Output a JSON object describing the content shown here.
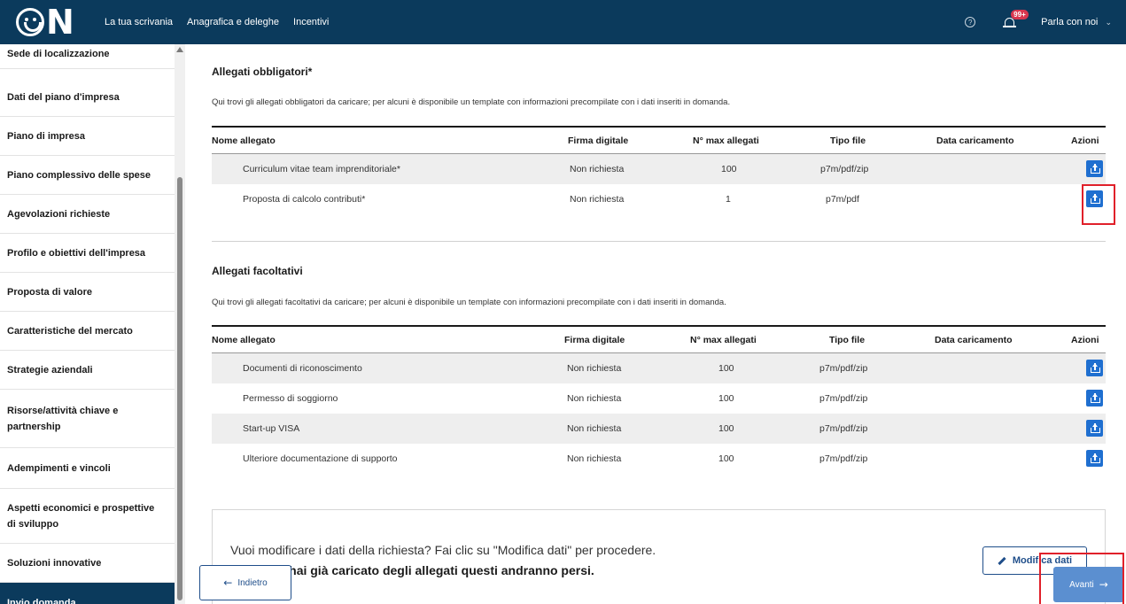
{
  "header": {
    "logo_text": "N",
    "nav": [
      "La tua scrivania",
      "Anagrafica e deleghe",
      "Incentivi"
    ],
    "help_glyph": "?",
    "notification_badge": "99+",
    "chat_label": "Parla con noi",
    "chat_chevron": "⌄"
  },
  "sidebar": {
    "items": [
      "Sede di localizzazione",
      "Dati del piano d'impresa",
      "Piano di impresa",
      "Piano complessivo delle spese",
      "Agevolazioni richieste",
      "Profilo e obiettivi dell'impresa",
      "Proposta di valore",
      "Caratteristiche del mercato",
      "Strategie aziendali",
      "Risorse/attività chiave e partnership",
      "Adempimenti e vincoli",
      "Aspetti economici e prospettive di sviluppo",
      "Soluzioni innovative",
      "Invio domanda"
    ]
  },
  "columns": {
    "name": "Nome allegato",
    "signature": "Firma digitale",
    "max": "N° max allegati",
    "type": "Tipo file",
    "date": "Data caricamento",
    "actions": "Azioni"
  },
  "mandatory": {
    "title": "Allegati obbligatori*",
    "description": "Qui trovi gli allegati obbligatori da caricare; per alcuni è disponibile un template con informazioni precompilate con i dati inseriti in domanda.",
    "rows": [
      {
        "name": "Curriculum vitae team imprenditoriale*",
        "signature": "Non richiesta",
        "max": "100",
        "type": "p7m/pdf/zip",
        "date": ""
      },
      {
        "name": "Proposta di calcolo contributi*",
        "signature": "Non richiesta",
        "max": "1",
        "type": "p7m/pdf",
        "date": ""
      }
    ]
  },
  "optional": {
    "title": "Allegati facoltativi",
    "description": "Qui trovi gli allegati facoltativi da caricare; per alcuni è disponibile un template con informazioni precompilate con i dati inseriti in domanda.",
    "rows": [
      {
        "name": "Documenti di riconoscimento",
        "signature": "Non richiesta",
        "max": "100",
        "type": "p7m/pdf/zip",
        "date": ""
      },
      {
        "name": "Permesso di soggiorno",
        "signature": "Non richiesta",
        "max": "100",
        "type": "p7m/pdf/zip",
        "date": ""
      },
      {
        "name": "Start-up VISA",
        "signature": "Non richiesta",
        "max": "100",
        "type": "p7m/pdf/zip",
        "date": ""
      },
      {
        "name": "Ulteriore documentazione di supporto",
        "signature": "Non richiesta",
        "max": "100",
        "type": "p7m/pdf/zip",
        "date": ""
      }
    ]
  },
  "edit": {
    "line1": "Vuoi modificare i dati della richiesta? Fai clic su \"Modifica dati\" per procedere.",
    "line2": "Anche se hai già caricato degli allegati questi andranno persi.",
    "button": "Modifica dati"
  },
  "footer": {
    "back": "Indietro",
    "back_arrow": "←",
    "next": "Avanti",
    "next_arrow": "→"
  },
  "colors": {
    "header_bg": "#0b3a5c",
    "upload_btn": "#1f6fd0",
    "highlight": "#e0202a",
    "next_btn": "#5b8fd0"
  }
}
